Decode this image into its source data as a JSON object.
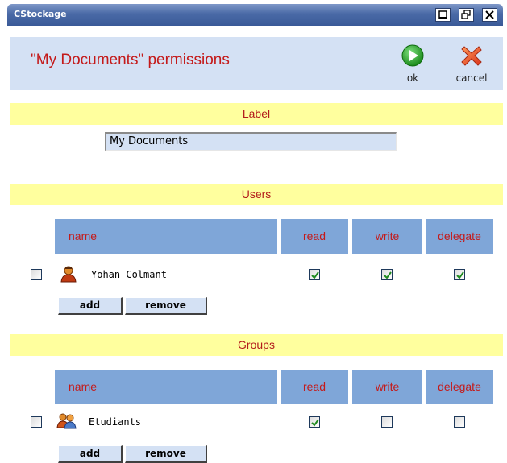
{
  "window": {
    "title": "CStockage"
  },
  "header": {
    "title": "\"My Documents\" permissions",
    "ok_label": "ok",
    "cancel_label": "cancel"
  },
  "label_section": {
    "heading": "Label",
    "value": "My Documents"
  },
  "users": {
    "heading": "Users",
    "columns": [
      "name",
      "read",
      "write",
      "delegate"
    ],
    "rows": [
      {
        "name": "Yohan Colmant",
        "icon": "user-icon",
        "selected": false,
        "read": true,
        "write": true,
        "delegate": true
      }
    ],
    "add_label": "add",
    "remove_label": "remove"
  },
  "groups": {
    "heading": "Groups",
    "columns": [
      "name",
      "read",
      "write",
      "delegate"
    ],
    "rows": [
      {
        "name": "Etudiants",
        "icon": "group-icon",
        "selected": false,
        "read": true,
        "write": false,
        "delegate": false
      }
    ],
    "add_label": "add",
    "remove_label": "remove"
  },
  "colors": {
    "titlebar": "#4a6aa6",
    "header_bg": "#d4e1f4",
    "section_bg": "#ffff9e",
    "column_header_bg": "#7fa6d8",
    "accent_text": "#c41a1a",
    "check": "#1f8a1f"
  }
}
